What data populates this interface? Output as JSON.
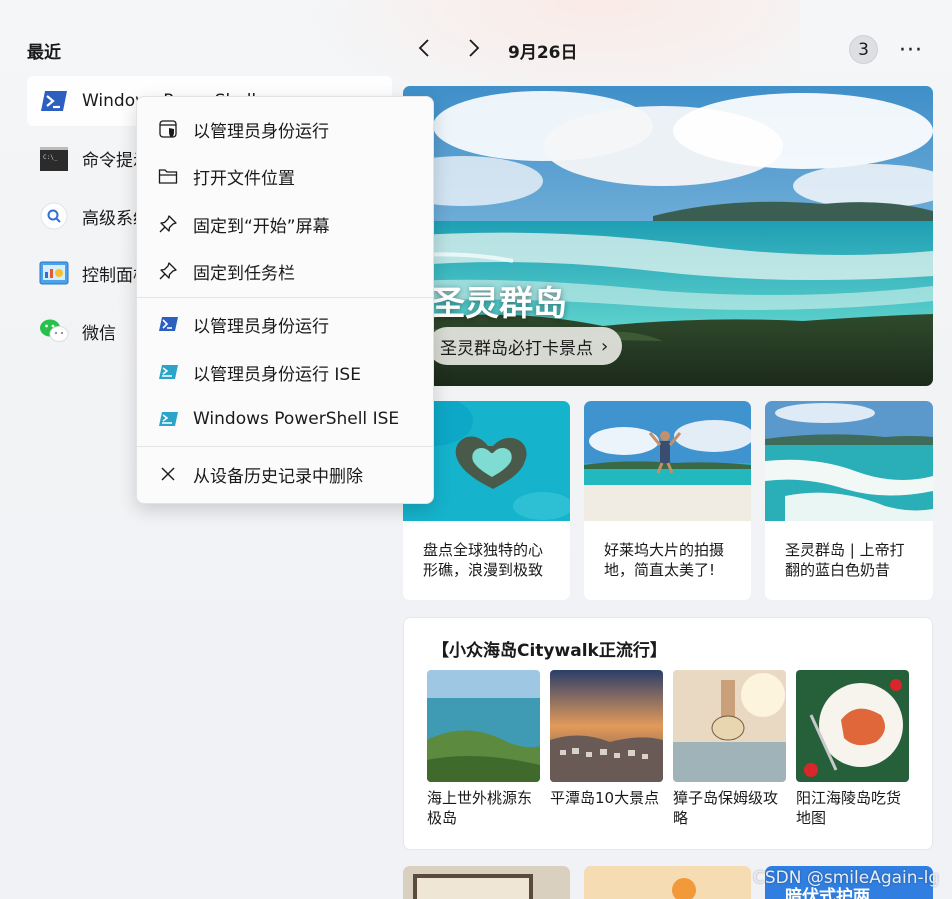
{
  "recent": {
    "title": "最近",
    "items": [
      {
        "label": "Windows PowerShell",
        "icon": "powershell-icon"
      },
      {
        "label": "命令提示符",
        "icon": "command-prompt-icon"
      },
      {
        "label": "高级系统设置",
        "icon": "search-settings-icon"
      },
      {
        "label": "控制面板",
        "icon": "control-panel-icon"
      },
      {
        "label": "微信",
        "icon": "wechat-icon"
      }
    ]
  },
  "header": {
    "date": "9月26日",
    "count": "3",
    "more": "···"
  },
  "hero": {
    "title": "圣灵群岛",
    "pill": "圣灵群岛必打卡景点"
  },
  "cards": [
    {
      "text": "盘点全球独特的心形礁，浪漫到极致"
    },
    {
      "text": "好莱坞大片的拍摄地，简直太美了!"
    },
    {
      "text": "圣灵群岛 | 上帝打翻的蓝白色奶昔"
    }
  ],
  "topic": {
    "title": "【小众海岛Citywalk正流行】",
    "items": [
      {
        "label": "海上世外桃源东极岛"
      },
      {
        "label": "平潭岛10大景点"
      },
      {
        "label": "獐子岛保姆级攻略"
      },
      {
        "label": "阳江海陵岛吃货地图"
      }
    ]
  },
  "bottom_card_text": "暗伏式护两",
  "watermark": "CSDN @smileAgain-lg",
  "context_menu": {
    "items": [
      {
        "label": "以管理员身份运行",
        "icon": "shield-icon"
      },
      {
        "label": "打开文件位置",
        "icon": "folder-icon"
      },
      {
        "label": "固定到“开始”屏幕",
        "icon": "pin-icon"
      },
      {
        "label": "固定到任务栏",
        "icon": "pin-icon"
      },
      {
        "label": "以管理员身份运行",
        "icon": "powershell-icon"
      },
      {
        "label": "以管理员身份运行 ISE",
        "icon": "powershell-ise-icon"
      },
      {
        "label": "Windows PowerShell ISE",
        "icon": "powershell-ise-icon"
      },
      {
        "label": "从设备历史记录中删除",
        "icon": "close-icon"
      }
    ]
  },
  "colors": {
    "accent": "#2f6fd6",
    "powershell": "#2c5fc0",
    "wechat": "#27c04a",
    "menu_bg": "#fbfbfb"
  }
}
